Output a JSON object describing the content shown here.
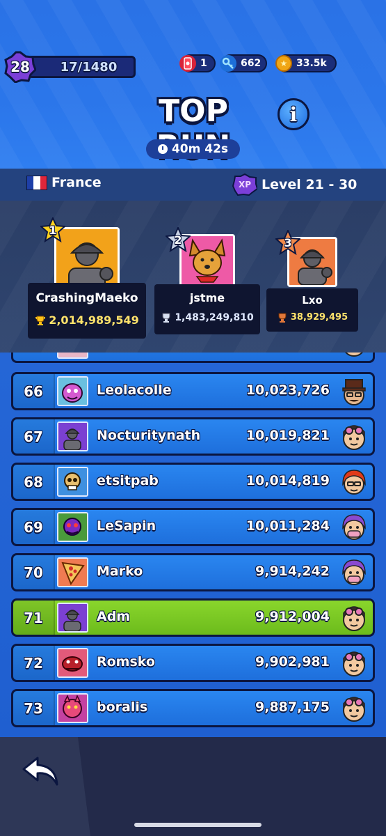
{
  "header": {
    "player_level": "28",
    "xp_progress": "17/1480",
    "currencies": [
      {
        "icon": "energy-can-icon",
        "value": "1"
      },
      {
        "icon": "key-icon",
        "value": "662"
      },
      {
        "icon": "coin-icon",
        "value": "33.5k"
      }
    ],
    "title": "TOP RUN",
    "info_label": "i",
    "timer": "40m 42s"
  },
  "filter": {
    "country": "France",
    "xp_badge": "XP",
    "level_range": "Level 21 - 30"
  },
  "podium": [
    {
      "rank": "1",
      "name": "CrashingMaeko",
      "score": "2,014,989,549"
    },
    {
      "rank": "2",
      "name": "jstme",
      "score": "1,483,249,810"
    },
    {
      "rank": "3",
      "name": "Lxo",
      "score": "38,929,495"
    }
  ],
  "leaderboard": [
    {
      "rank": "66",
      "name": "Leolacolle",
      "score": "10,023,726",
      "avatar": "pink-monster-avatar",
      "hero": "top-hat-hero"
    },
    {
      "rank": "67",
      "name": "Nocturitynath",
      "score": "10,019,821",
      "avatar": "default-silhouette-avatar",
      "hero": "goggles-hero"
    },
    {
      "rank": "68",
      "name": "etsitpab",
      "score": "10,014,819",
      "avatar": "skull-monster-avatar",
      "hero": "red-hair-hero"
    },
    {
      "rank": "69",
      "name": "LeSapin",
      "score": "10,011,284",
      "avatar": "purple-mask-avatar",
      "hero": "purple-hair-hero"
    },
    {
      "rank": "70",
      "name": "Marko",
      "score": "9,914,242",
      "avatar": "pizza-avatar",
      "hero": "purple-hair-hero"
    },
    {
      "rank": "71",
      "name": "Adm",
      "score": "9,912,004",
      "avatar": "default-silhouette-avatar",
      "hero": "goggles-hero",
      "is_me": true
    },
    {
      "rank": "72",
      "name": "Romsko",
      "score": "9,902,981",
      "avatar": "red-creature-avatar",
      "hero": "goggles-hero"
    },
    {
      "rank": "73",
      "name": "boralis",
      "score": "9,887,175",
      "avatar": "pink-beast-avatar",
      "hero": "goggles-hero"
    }
  ],
  "colors": {
    "row_blue": "#1e6fdc",
    "row_me_green": "#7ac825",
    "score_gold": "#ffe36b",
    "outline": "#0b1640"
  }
}
